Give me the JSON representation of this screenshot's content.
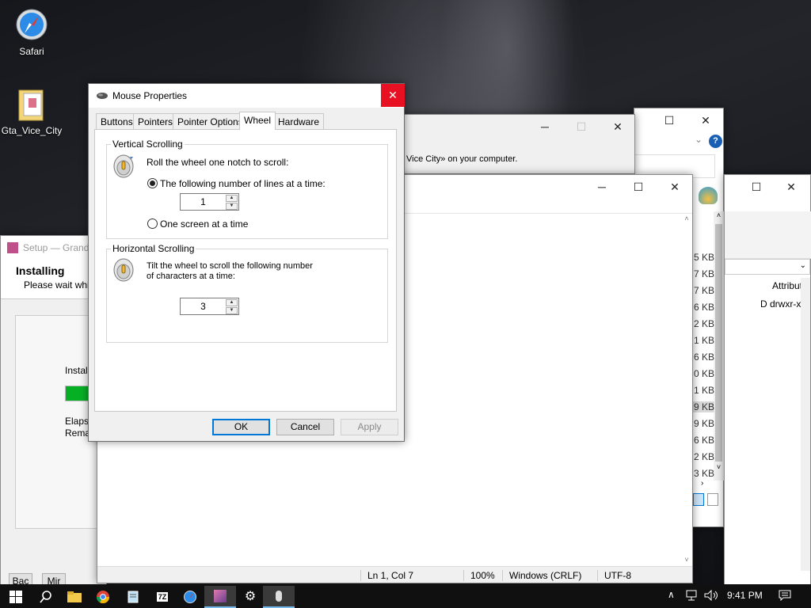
{
  "desktop": {
    "icons": [
      {
        "label": "Safari",
        "icon": "safari-compass-icon"
      },
      {
        "label": "Gta_Vice_City",
        "icon": "folder-archive-icon"
      }
    ]
  },
  "setup": {
    "title": "Setup — Grand",
    "heading": "Installing",
    "subtext": "Please wait while",
    "status": "Install",
    "progress": 0.2,
    "elapsed": "Elapse",
    "remaining": "Remain",
    "btn1": "Bac",
    "btn2": "Mir"
  },
  "dialog2": {
    "text": "Vice City» on your computer.",
    "help": "?"
  },
  "explorer": {
    "sizes": [
      "5 KB",
      "7 KB",
      "7 KB",
      "6 KB",
      "2 KB",
      "1 KB",
      "6 KB",
      "0 KB",
      "1 KB",
      "9 KB",
      "9 KB",
      "6 KB",
      "2 KB",
      "3 KB"
    ],
    "col_header": "Attribute",
    "row_text": "D drwxr-xr-"
  },
  "notepad": {
    "status": {
      "position": "Ln 1, Col 7",
      "zoom": "100%",
      "line_ending": "Windows (CRLF)",
      "encoding": "UTF-8"
    }
  },
  "mouse": {
    "title": "Mouse Properties",
    "tabs": [
      "Buttons",
      "Pointers",
      "Pointer Options",
      "Wheel",
      "Hardware"
    ],
    "active_tab": "Wheel",
    "vertical": {
      "label": "Vertical Scrolling",
      "desc": "Roll the wheel one notch to scroll:",
      "option_lines": "The following number of lines at a time:",
      "lines_value": "1",
      "option_screen": "One screen at a time"
    },
    "horizontal": {
      "label": "Horizontal Scrolling",
      "desc_1": "Tilt the wheel to scroll the following number",
      "desc_2": "of characters at a time:",
      "chars_value": "3"
    },
    "buttons": {
      "ok": "OK",
      "cancel": "Cancel",
      "apply": "Apply"
    }
  },
  "taskbar": {
    "time": "9:41 PM"
  },
  "colors": {
    "accent": "#0078d7",
    "close_red": "#e81123",
    "progress_green": "#06b025"
  }
}
